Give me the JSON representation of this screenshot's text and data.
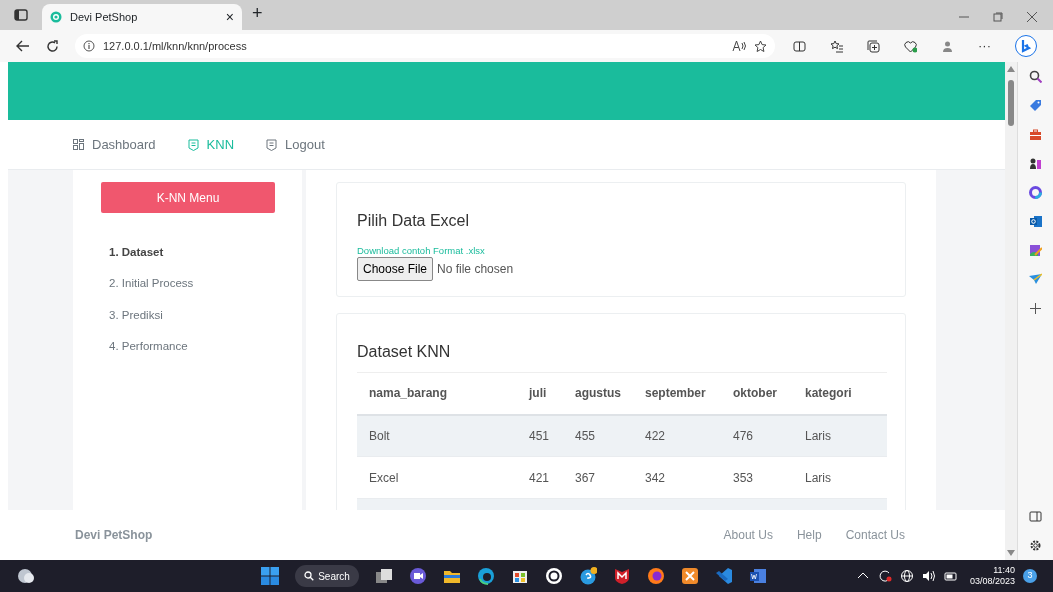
{
  "browser": {
    "tab_title": "Devi PetShop",
    "close_tab": "×",
    "new_tab": "+",
    "address": "127.0.0.1/ml/knn/knn/process",
    "more": "···"
  },
  "nav": [
    {
      "label": "Dashboard",
      "kind": "grid",
      "selected": false
    },
    {
      "label": "KNN",
      "kind": "doc",
      "selected": true
    },
    {
      "label": "Logout",
      "kind": "doc",
      "selected": false
    }
  ],
  "sidebar": {
    "button": "K-NN Menu",
    "items": [
      {
        "label": "1. Dataset",
        "selected": true
      },
      {
        "label": "2. Initial Process",
        "selected": false
      },
      {
        "label": "3. Prediksi",
        "selected": false
      },
      {
        "label": "4. Performance",
        "selected": false
      }
    ]
  },
  "upload_card": {
    "title": "Pilih Data Excel",
    "link": "Download contoh Format .xlsx",
    "file_button": "Choose File",
    "file_status": "No file chosen"
  },
  "dataset_card": {
    "title": "Dataset KNN",
    "table": {
      "columns": [
        "nama_barang",
        "juli",
        "agustus",
        "september",
        "oktober",
        "kategori"
      ],
      "rows": [
        [
          "Bolt",
          "451",
          "455",
          "422",
          "476",
          "Laris"
        ],
        [
          "Excel",
          "421",
          "367",
          "342",
          "353",
          "Laris"
        ]
      ]
    }
  },
  "footer": {
    "brand": "Devi PetShop",
    "links": [
      "About Us",
      "Help",
      "Contact Us"
    ]
  },
  "taskbar": {
    "search": "Search",
    "time": "11:40",
    "date": "03/08/2023",
    "notifications": "3"
  }
}
